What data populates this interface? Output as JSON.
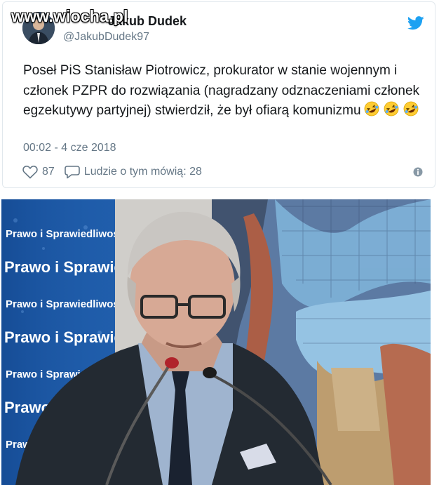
{
  "watermark": "www.wiocha.pl",
  "tweet": {
    "display_name": "Jakub Dudek",
    "handle": "@JakubDudek97",
    "text": "Poseł PiS Stanisław Piotrowicz, prokurator w stanie wojennym i członek PZPR do rozwiązania (nagradzany odznaczeniami członek egzekutywy partyjnej) stwierdził, że był ofiarą komunizmu",
    "emoji": [
      "rofl",
      "rofl",
      "rofl"
    ],
    "timestamp": "00:02 - 4 cze 2018",
    "likes": "87",
    "discussion_label": "Ludzie o tym mówią: 28"
  },
  "photo": {
    "banner_text": "Prawo i Sprawiedliwość"
  },
  "icons": {
    "brand": "twitter-bird-icon",
    "like": "heart-icon",
    "reply": "speech-bubble-icon",
    "info": "info-icon"
  },
  "colors": {
    "brand_blue": "#1da1f2",
    "text": "#14171a",
    "muted": "#657786",
    "banner_blue": "#1d5aa6"
  }
}
